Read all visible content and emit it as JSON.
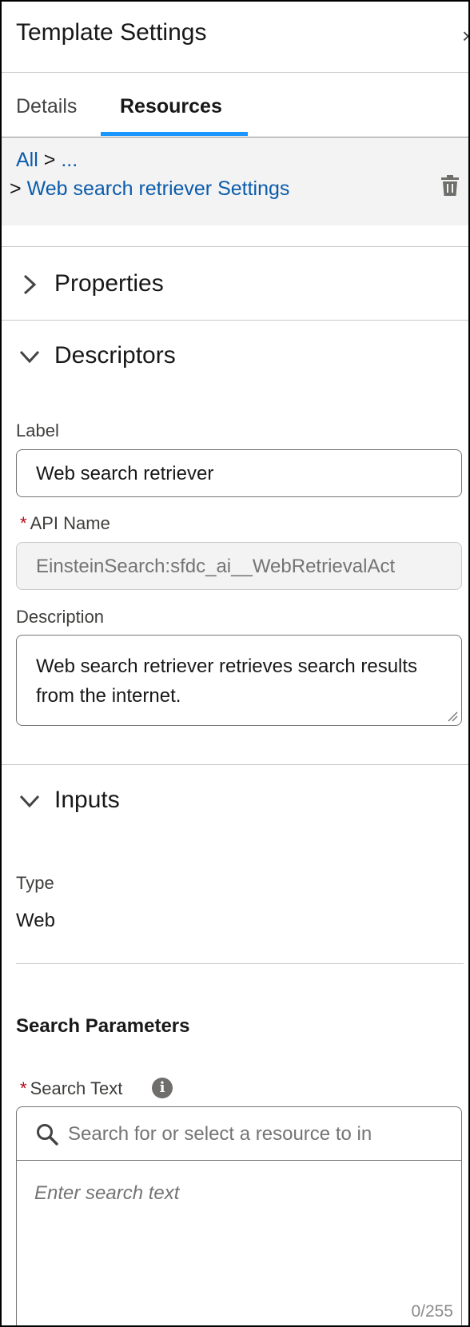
{
  "header": {
    "title": "Template Settings",
    "close_glyph": "×"
  },
  "tabs": [
    {
      "label": "Details",
      "active": false
    },
    {
      "label": "Resources",
      "active": true
    }
  ],
  "breadcrumb": {
    "root": "All",
    "separator": ">",
    "ellipsis": "...",
    "current": "Web search retriever Settings"
  },
  "sections": {
    "properties": {
      "title": "Properties",
      "expanded": false
    },
    "descriptors": {
      "title": "Descriptors",
      "expanded": true
    },
    "inputs": {
      "title": "Inputs",
      "expanded": true
    }
  },
  "descriptors": {
    "label_label": "Label",
    "label_value": "Web search retriever",
    "required_mark": "*",
    "api_name_label": "API Name",
    "api_name_value": "EinsteinSearch:sfdc_ai__WebRetrievalAct",
    "description_label": "Description",
    "description_value": "Web search retriever retrieves search results from the internet."
  },
  "inputs": {
    "type_label": "Type",
    "type_value": "Web",
    "search_parameters_title": "Search Parameters",
    "search_text_label": "Search Text",
    "info_glyph": "i",
    "resource_search_placeholder": "Search for or select a resource to in",
    "search_text_placeholder": "Enter search text",
    "char_counter": "0/255"
  },
  "colors": {
    "link": "#0b5cab",
    "tab_indicator": "#1b96ff",
    "required": "#ba0517",
    "breadcrumb_bg": "#f3f3f3"
  },
  "icons": [
    "close-icon",
    "trash-icon",
    "chevron-right-icon",
    "chevron-down-icon",
    "info-icon",
    "search-icon",
    "resize-handle-icon"
  ]
}
